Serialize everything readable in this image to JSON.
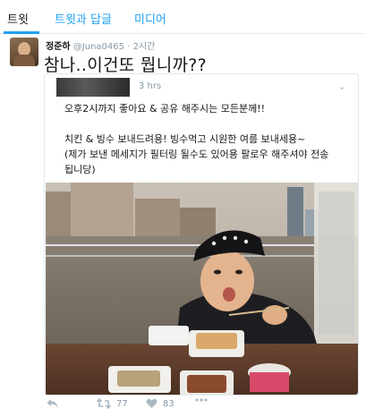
{
  "tabs": [
    {
      "label": "트윗"
    },
    {
      "label": "트윗과 답글"
    },
    {
      "label": "미디어"
    }
  ],
  "tweet": {
    "user_name": "정준하",
    "handle": "@Juna0465",
    "separator": "·",
    "time": "2시간",
    "text": "참나..이건또 뭡니까??"
  },
  "quoted": {
    "time": "3 hrs",
    "lines": [
      "오후2시까지 좋아요 & 공유 해주시는 모든분께!!",
      "",
      "치킨 & 빙수 보내드려용! 빙수먹고 시원한 여름 보내세용~",
      "(제가 보낸 메세지가 필터링 될수도 있어용 팔로우 해주셔야 전송",
      "됩니당)"
    ]
  },
  "actions": {
    "retweet_count": "77",
    "like_count": "83"
  },
  "colors": {
    "accent": "#1da1f2",
    "muted": "#8899a6",
    "border": "#e1e8ed"
  }
}
